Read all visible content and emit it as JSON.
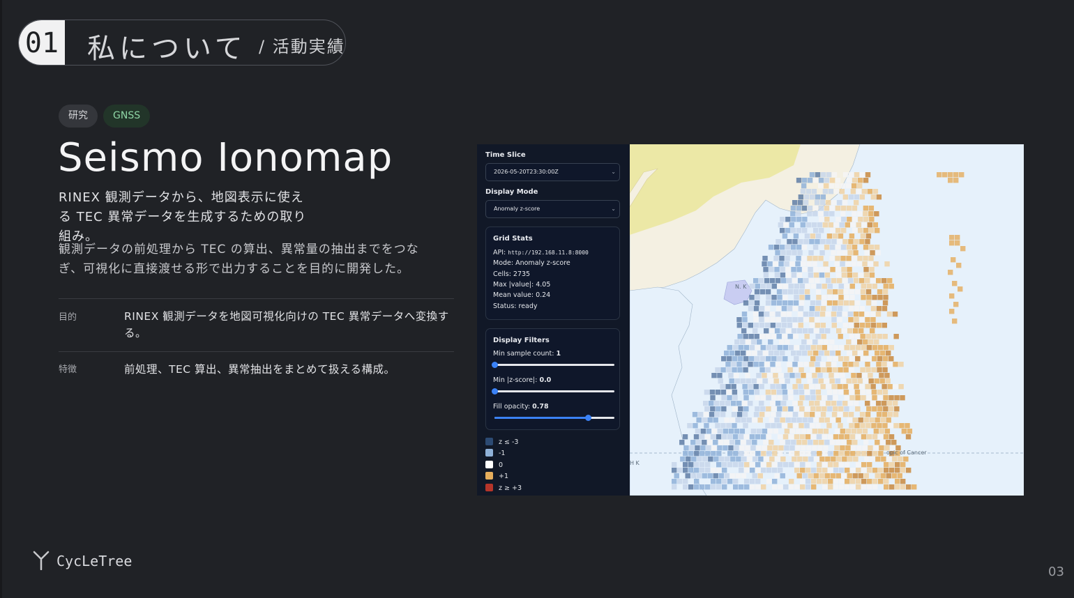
{
  "header": {
    "number": "01",
    "title": "私について",
    "subtitle": "/ 活動実績"
  },
  "tags": [
    "研究",
    "GNSS"
  ],
  "project": {
    "title": "Seismo Ionomap",
    "lead": "RINEX 観測データから、地図表示に使える TEC 異常データを生成するための取り組み。",
    "description": "観測データの前処理から TEC の算出、異常量の抽出までをつなぎ、可視化に直接渡せる形で出力することを目的に開発した。",
    "details": [
      {
        "term": "目的",
        "text": "RINEX 観測データを地図可視化向けの TEC 異常データへ変換する。"
      },
      {
        "term": "特徴",
        "text": "前処理、TEC 算出、異常抽出をまとめて扱える構成。"
      }
    ]
  },
  "app": {
    "time_slice_label": "Time Slice",
    "time_slice_value": "2026-05-20T23:30:00Z",
    "display_mode_label": "Display Mode",
    "display_mode_value": "Anomaly z-score",
    "grid_stats": {
      "title": "Grid Stats",
      "api_label": "API:",
      "api_value": "http://192.168.11.8:8000",
      "mode": "Mode: Anomaly z-score",
      "cells": "Cells: 2735",
      "max": "Max |value|: 4.05",
      "mean": "Mean value: 0.24",
      "status": "Status: ready"
    },
    "filters": {
      "title": "Display Filters",
      "items": [
        {
          "label": "Min sample count: ",
          "value": "1",
          "fraction": 0.0
        },
        {
          "label": "Min |z-score|: ",
          "value": "0.0",
          "fraction": 0.0
        },
        {
          "label": "Fill opacity: ",
          "value": "0.78",
          "fraction": 0.78
        }
      ]
    },
    "legend": [
      {
        "label": "z ≤ -3",
        "color": "#2c4a73"
      },
      {
        "label": "-1",
        "color": "#8fb1d8"
      },
      {
        "label": "0",
        "color": "#ffffff"
      },
      {
        "label": "+1",
        "color": "#e5ad5c"
      },
      {
        "label": "z ≥ +3",
        "color": "#b5352a"
      }
    ],
    "map_labels": {
      "cancer": "opic of Cancer",
      "nk": "N. K",
      "hk": "H K"
    },
    "colors": {
      "land": "#f4f0e2",
      "china": "#ece8a6",
      "korea_nk": "#c9cdf2",
      "sea": "#e6f1fb"
    }
  },
  "footer": {
    "brand": "CycLeTree",
    "page": "03"
  }
}
